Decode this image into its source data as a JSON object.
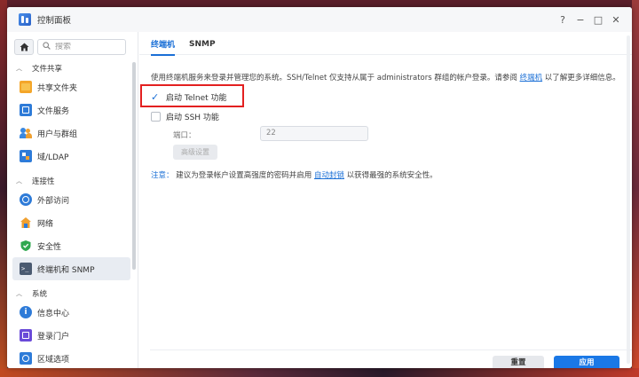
{
  "window": {
    "title": "控制面板",
    "controls": [
      "?",
      "−",
      "□",
      "✕"
    ]
  },
  "sidebar": {
    "search_placeholder": "搜索",
    "groups": [
      {
        "label": "文件共享",
        "items": [
          {
            "label": "共享文件夹",
            "icon": "shared-folder-icon"
          },
          {
            "label": "文件服务",
            "icon": "file-services-icon"
          },
          {
            "label": "用户与群组",
            "icon": "users-groups-icon"
          },
          {
            "label": "域/LDAP",
            "icon": "domain-ldap-icon"
          }
        ]
      },
      {
        "label": "连接性",
        "items": [
          {
            "label": "外部访问",
            "icon": "external-access-icon"
          },
          {
            "label": "网络",
            "icon": "network-icon"
          },
          {
            "label": "安全性",
            "icon": "security-icon"
          },
          {
            "label": "终端机和 SNMP",
            "icon": "terminal-snmp-icon",
            "active": true
          }
        ]
      },
      {
        "label": "系统",
        "items": [
          {
            "label": "信息中心",
            "icon": "info-center-icon"
          },
          {
            "label": "登录门户",
            "icon": "login-portal-icon"
          },
          {
            "label": "区域选项",
            "icon": "regional-options-icon"
          }
        ]
      }
    ]
  },
  "tabs": [
    {
      "label": "终端机",
      "active": true
    },
    {
      "label": "SNMP",
      "active": false
    }
  ],
  "terminal": {
    "description_prefix": "使用终端机服务来登录并管理您的系统。SSH/Telnet 仅支持从属于 administrators 群组的帐户登录。请参阅",
    "description_link": "终端机",
    "description_suffix": "以了解更多详细信息。",
    "telnet_label": "启动 Telnet 功能",
    "telnet_checked": true,
    "ssh_label": "启动 SSH 功能",
    "ssh_checked": false,
    "port_label": "端口：",
    "port_value": "22",
    "advanced_button": "高级设置",
    "note_label": "注意：",
    "note_prefix": "建议为登录帐户设置高强度的密码并启用",
    "note_link": "自动封锁",
    "note_suffix": "以获得最强的系统安全性。"
  },
  "footer": {
    "reset_label": "重置",
    "apply_label": "应用"
  },
  "colors": {
    "accent": "#1a78e6",
    "highlight_box": "#e32020"
  }
}
